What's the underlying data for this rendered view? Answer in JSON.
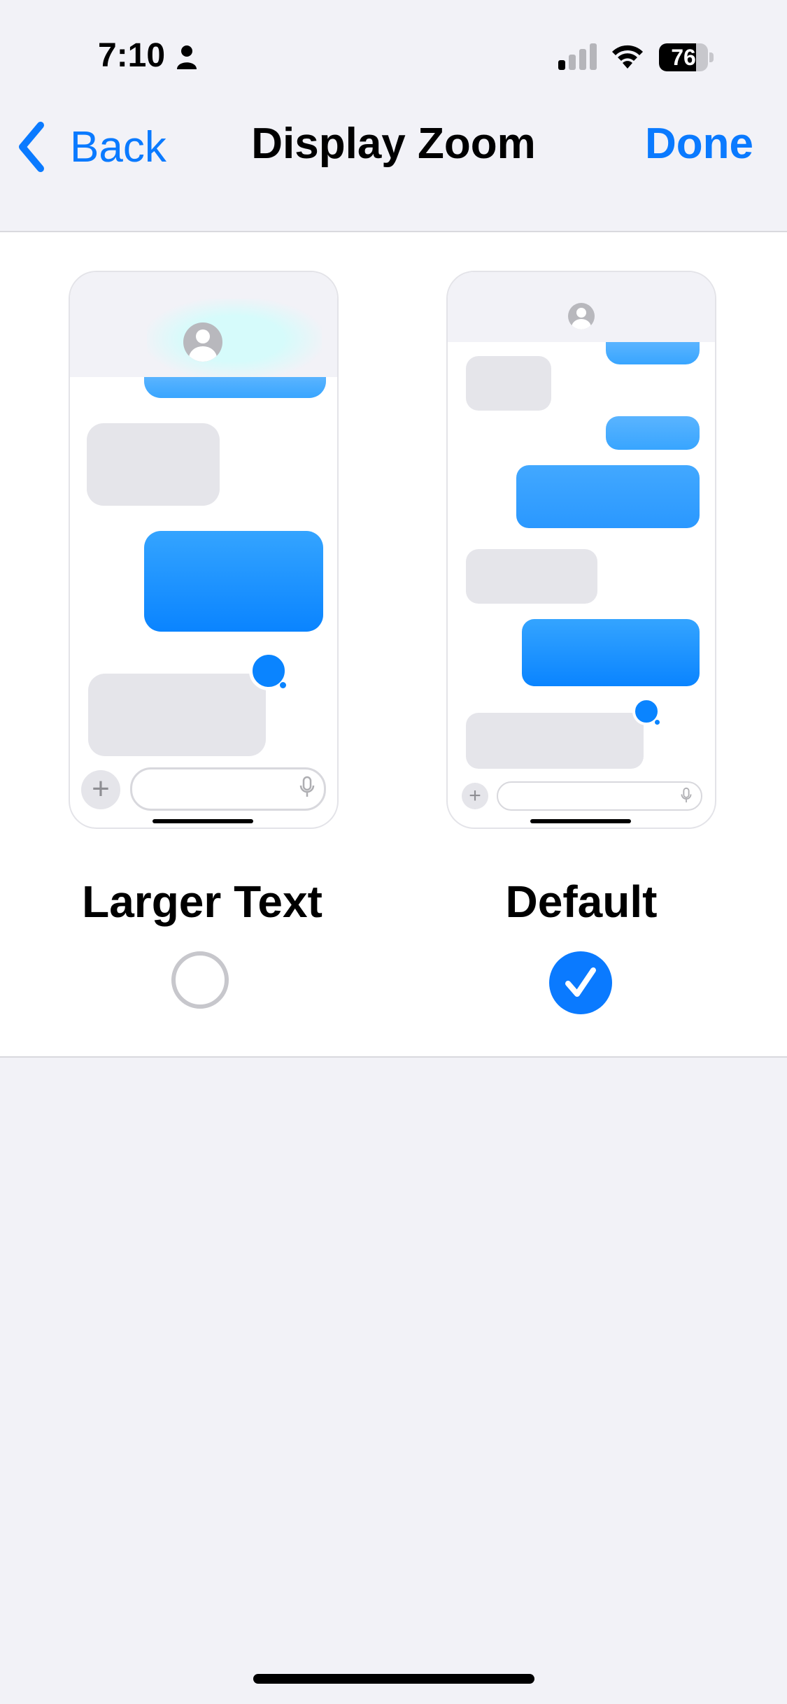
{
  "status_bar": {
    "time": "7:10",
    "battery_level": "76"
  },
  "nav": {
    "back_label": "Back",
    "title": "Display Zoom",
    "done_label": "Done"
  },
  "options": [
    {
      "label": "Larger Text",
      "selected": false
    },
    {
      "label": "Default",
      "selected": true
    }
  ],
  "colors": {
    "accent": "#0a7aff",
    "background": "#f2f2f7",
    "bubble_gray": "#e5e5ea",
    "bubble_blue": "#0a84ff"
  }
}
